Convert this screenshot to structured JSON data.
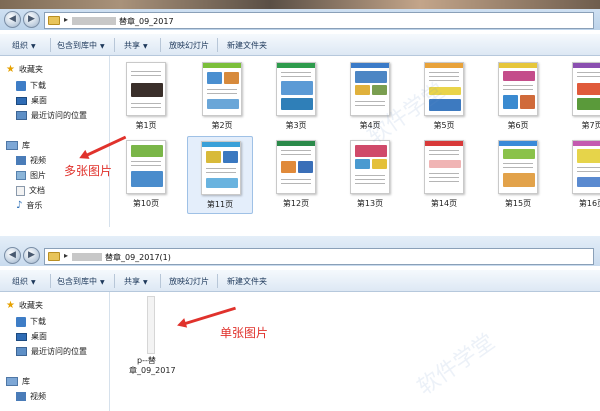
{
  "window1": {
    "path": "替章_09_2017",
    "toolbar": {
      "organize": "组织",
      "include_library": "包含到库中",
      "share": "共享",
      "slideshow": "放映幻灯片",
      "new_folder": "新建文件夹"
    },
    "nav": {
      "favorites": "收藏夹",
      "downloads": "下载",
      "desktop": "桌面",
      "recent": "最近访问的位置",
      "library": "库",
      "videos": "视频",
      "pictures": "图片",
      "documents": "文档",
      "music": "音乐"
    },
    "thumbnails": [
      "第1页",
      "第2页",
      "第3页",
      "第4页",
      "第5页",
      "第6页",
      "第7页",
      "第10页",
      "第11页",
      "第12页",
      "第13页",
      "第14页",
      "第15页",
      "第16页"
    ],
    "annotation": "多张图片"
  },
  "window2": {
    "path": "替章_09_2017(1)",
    "toolbar": {
      "organize": "组织",
      "include_library": "包含到库中",
      "share": "共享",
      "slideshow": "放映幻灯片",
      "new_folder": "新建文件夹"
    },
    "nav": {
      "favorites": "收藏夹",
      "downloads": "下载",
      "desktop": "桌面",
      "recent": "最近访问的位置",
      "library": "库",
      "videos": "视频"
    },
    "file": {
      "name_line1": "p--替",
      "name_line2": "章_09_2017"
    },
    "annotation": "单张图片"
  },
  "watermark": "软件学堂",
  "colors": {
    "annotation_red": "#e0322c",
    "toolbar_text": "#1e395b",
    "selection": "#e4eefb"
  }
}
